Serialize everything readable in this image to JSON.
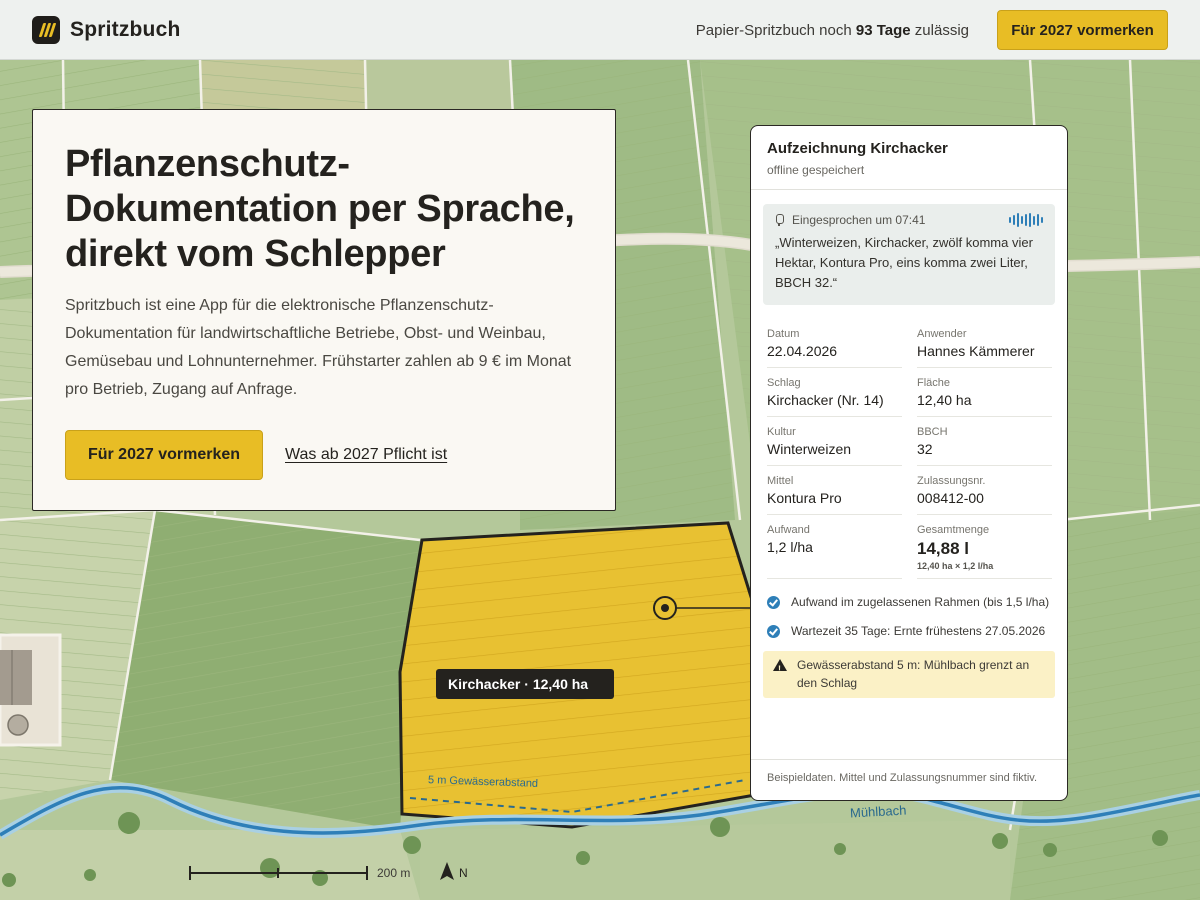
{
  "header": {
    "brand": "Spritzbuch",
    "notice_prefix": "Papier-Spritzbuch noch",
    "notice_days": "93 Tage",
    "notice_suffix": "zulässig",
    "cta_label": "Für 2027 vormerken"
  },
  "hero": {
    "title": "Pflanzenschutz-Dokumentation per Sprache, direkt vom Schlepper",
    "description": "Spritzbuch ist eine App für die elektronische Pflanzenschutz-Dokumentation für landwirtschaftliche Betriebe, Obst- und Weinbau, Gemüsebau und Lohnunternehmer. Frühstarter zahlen ab 9 € im Monat pro Betrieb, Zugang auf Anfrage.",
    "cta_label": "Für 2027 vormerken",
    "link_label": "Was ab 2027 Pflicht ist"
  },
  "record": {
    "title": "Aufzeichnung Kirchacker",
    "subtitle": "offline gespeichert",
    "voice": {
      "label": "Eingesprochen um 07:41",
      "transcript": "„Winterweizen, Kirchacker, zwölf komma vier Hektar, Kontura Pro, eins komma zwei Liter, BBCH 32.“"
    },
    "fields": [
      {
        "label": "Datum",
        "value": "22.04.2026"
      },
      {
        "label": "Anwender",
        "value": "Hannes Kämmerer"
      },
      {
        "label": "Schlag",
        "value": "Kirchacker (Nr. 14)"
      },
      {
        "label": "Fläche",
        "value": "12,40 ha"
      },
      {
        "label": "Kultur",
        "value": "Winterweizen"
      },
      {
        "label": "BBCH",
        "value": "32"
      },
      {
        "label": "Mittel",
        "value": "Kontura Pro"
      },
      {
        "label": "Zulassungsnr.",
        "value": "008412-00"
      },
      {
        "label": "Aufwand",
        "value": "1,2 l/ha"
      },
      {
        "label": "Gesamtmenge",
        "value": "14,88 l",
        "note": "12,40 ha × 1,2 l/ha"
      }
    ],
    "checks": [
      "Aufwand im zugelassenen Rahmen (bis 1,5 l/ha)",
      "Wartezeit 35 Tage: Ernte frühestens 27.05.2026"
    ],
    "warning": "Gewässerabstand 5 m: Mühlbach grenzt an den Schlag",
    "footer": "Beispieldaten. Mittel und Zulassungsnummer sind fiktiv."
  },
  "map": {
    "field_label": "Kirchacker · 12,40 ha",
    "buffer_label": "5 m Gewässerabstand",
    "creek_label": "Mühlbach",
    "scale_label": "200 m",
    "north_label": "N",
    "colors": {
      "field_highlight": "#e8c132",
      "creek": "#2e7fb8",
      "accent": "#e8bd25"
    }
  }
}
